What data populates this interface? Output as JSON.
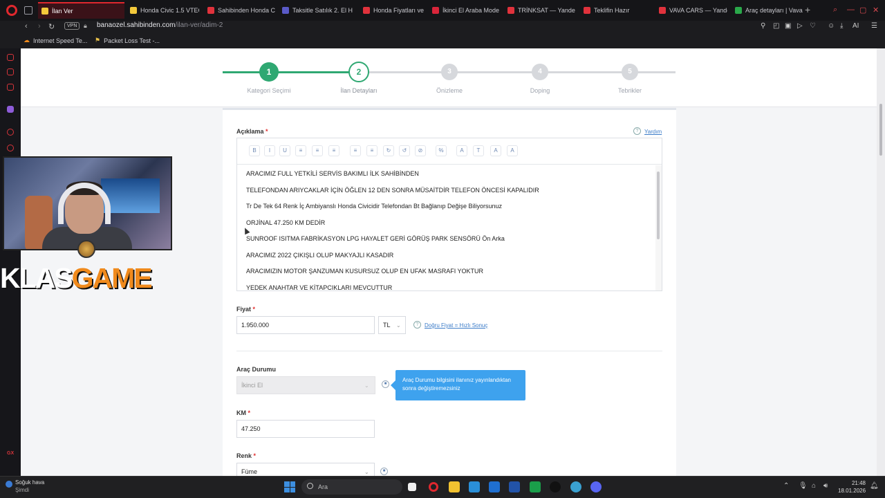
{
  "browser": {
    "tabs": [
      {
        "label": "İlan Ver",
        "color": "#f3c93b",
        "active": true
      },
      {
        "label": "Honda Civic 1.5 VTEC",
        "color": "#f3c93b"
      },
      {
        "label": "Sahibinden Honda C",
        "color": "#e0323c"
      },
      {
        "label": "Taksitle Satılık 2. El H",
        "color": "#5a5ac8"
      },
      {
        "label": "Honda Fiyatları ve M",
        "color": "#e0323c"
      },
      {
        "label": "İkinci El Araba Model",
        "color": "#d9253a"
      },
      {
        "label": "TRİNKSAT — Yandex",
        "color": "#e0323c"
      },
      {
        "label": "Teklifin Hazır",
        "color": "#e0323c"
      },
      {
        "label": "VAVA CARS — Yande",
        "color": "#e0323c"
      },
      {
        "label": "Araç detayları | Vava",
        "color": "#2aa84a"
      }
    ],
    "url_domain": "banaozel.sahibinden.com",
    "url_path": "/ilan-ver/adim-2",
    "vpn_label": "VPN",
    "ai_label": "AI",
    "bookmarks": [
      {
        "label": "Internet Speed Te...",
        "icon": "cloud-icon",
        "color": "#f08a1c"
      },
      {
        "label": "Packet Loss Test -...",
        "icon": "flag-icon",
        "color": "#e8c04a"
      }
    ]
  },
  "steps": [
    {
      "num": "1",
      "label": "Kategori Seçimi",
      "state": "done"
    },
    {
      "num": "2",
      "label": "İlan Detayları",
      "state": "current"
    },
    {
      "num": "3",
      "label": "Önizleme",
      "state": "todo"
    },
    {
      "num": "4",
      "label": "Doping",
      "state": "todo"
    },
    {
      "num": "5",
      "label": "Tebrikler",
      "state": "todo"
    }
  ],
  "form": {
    "description_label": "Açıklama",
    "help_label": "Yardım",
    "toolbar": [
      "B",
      "I",
      "U",
      "≡",
      "≡",
      "≡",
      "≡",
      "≡",
      "↻",
      "↺",
      "⊘",
      "%",
      "A",
      "T",
      "A",
      "A"
    ],
    "description_lines": [
      "ARACIMIZ FULL YETKİLİ SERVİS BAKIMLI İLK SAHİBİNDEN",
      "TELEFONDAN ARIYCAKLAR İÇİN ÖĞLEN 12 DEN SONRA MÜSAİTDİR TELEFON ÖNCESİ KAPALIDIR",
      "Tr  De Tek 64 Renk İç Ambiyanslı Honda Civicidir Telefondan Bt Bağlanıp Değişe Biliyorsunuz",
      "ORJİNAL 47.250 KM DEDİR",
      "SUNROOF ISITMA FABRİKASYON LPG HAYALET  GERİ GÖRÜŞ PARK SENSÖRÜ Ön Arka",
      "ARACIMIZ 2022 ÇIKIŞLI OLUP MAKYAJLI KASADIR",
      "ARACIMIZIN  MOTOR ŞANZUMAN KUSURSUZ OLUP EN UFAK MASRAFI YOKTUR",
      "YEDEK ANAHTAR VE KİTAPCIKLARI MEVCUTTUR"
    ],
    "price_label": "Fiyat",
    "price_value": "1.950.000",
    "currency": "TL",
    "price_link": "Doğru Fiyat = Hızlı Sonuç",
    "condition_label": "Araç Durumu",
    "condition_value": "İkinci El",
    "condition_tooltip": "Araç Durumu bilgisini ilanınız yayınlandıktan sonra değiştiremezsiniz",
    "km_label": "KM",
    "km_value": "47.250",
    "color_label": "Renk",
    "color_value": "Füme",
    "required_mark": "*",
    "help_mark": "?"
  },
  "overlay": {
    "brand_left": "KLAS",
    "brand_right": "GAME"
  },
  "taskbar": {
    "weather_title": "Soğuk hava",
    "weather_sub": "Şimdi",
    "search_placeholder": "Ara",
    "time": "21:48",
    "date": "18.01.2026"
  },
  "colors": {
    "accent_green": "#2fa872",
    "step_gray": "#d6d8dc",
    "link_blue": "#3a7bc8",
    "tooltip_blue": "#3ea2ee",
    "opera_red": "#e0282e"
  }
}
